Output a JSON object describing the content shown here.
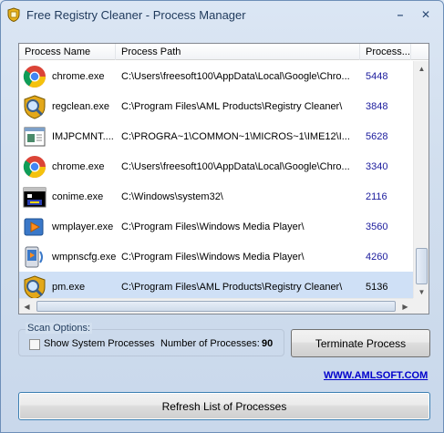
{
  "window": {
    "title": "Free Registry Cleaner - Process Manager"
  },
  "titlebar_buttons": {
    "minimize": "–",
    "close": "✕"
  },
  "list": {
    "columns": [
      "Process Name",
      "Process Path",
      "Process..."
    ],
    "rows": [
      {
        "name": "chrome.exe",
        "path": "C:\\Users\\freesoft100\\AppData\\Local\\Google\\Chro...",
        "pid": "5448",
        "icon": "chrome-icon"
      },
      {
        "name": "regclean.exe",
        "path": "C:\\Program Files\\AML Products\\Registry Cleaner\\",
        "pid": "3848",
        "icon": "registry-cleaner-icon"
      },
      {
        "name": "IMJPCMNT....",
        "path": "C:\\PROGRA~1\\COMMON~1\\MICROS~1\\IME12\\I...",
        "pid": "5628",
        "icon": "ime-window-icon"
      },
      {
        "name": "chrome.exe",
        "path": "C:\\Users\\freesoft100\\AppData\\Local\\Google\\Chro...",
        "pid": "3340",
        "icon": "chrome-icon"
      },
      {
        "name": "conime.exe",
        "path": "C:\\Windows\\system32\\",
        "pid": "2116",
        "icon": "console-ime-icon"
      },
      {
        "name": "wmplayer.exe",
        "path": "C:\\Program Files\\Windows Media Player\\",
        "pid": "3560",
        "icon": "media-player-icon"
      },
      {
        "name": "wmpnscfg.exe",
        "path": "C:\\Program Files\\Windows Media Player\\",
        "pid": "4260",
        "icon": "media-player-network-icon"
      },
      {
        "name": "pm.exe",
        "path": "C:\\Program Files\\AML Products\\Registry Cleaner\\",
        "pid": "5136",
        "icon": "registry-cleaner-icon",
        "selected": true
      }
    ]
  },
  "scan_options": {
    "legend": "Scan Options:",
    "show_system_label": "Show System Processes",
    "show_system_checked": false,
    "count_label": "Number of Processes:",
    "count_value": "90"
  },
  "buttons": {
    "terminate": "Terminate Process",
    "refresh": "Refresh List of Processes"
  },
  "link": "WWW.AMLSOFT.COM",
  "colors": {
    "window_bg": "#d1deee",
    "selected_row": "#cfe0f6",
    "pid_text": "#1a1a9c",
    "link": "#0000cc"
  }
}
